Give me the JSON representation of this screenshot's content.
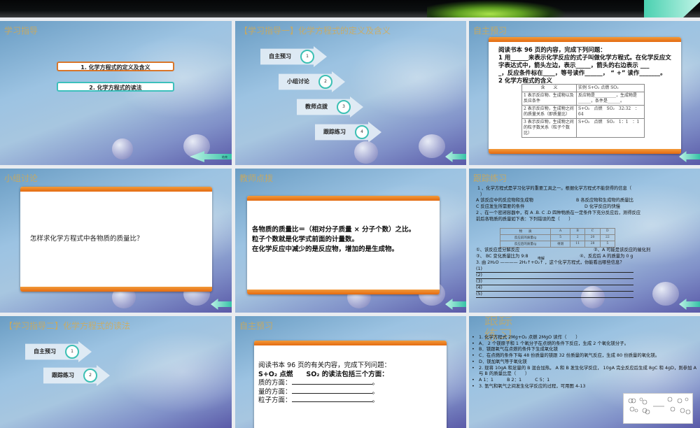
{
  "slides": [
    {
      "title": "学习指导",
      "items": [
        "1. 化学方程式的定义及含义",
        "2. 化学方程式的读法"
      ],
      "nav_label": "结束"
    },
    {
      "title": "【学习指导一】化学方程式的定义及含义",
      "steps": [
        {
          "label": "自主预习",
          "num": "1"
        },
        {
          "label": "小组讨论",
          "num": "2"
        },
        {
          "label": "教师点拨",
          "num": "3"
        },
        {
          "label": "跟踪练习",
          "num": "4"
        }
      ]
    },
    {
      "title": "自主预习",
      "lines": [
        "阅读书本 96 页的内容，完成下列问题：",
        "1 用______来表示化学反应的式子叫做化学方程式。在化学反应文字表达式中，箭头左边，表示_____，箭头的右边表示 ___",
        "_，反应条件标在____，等号读作______，  “ +” 读作_______。",
        "2 化学方程式的含义"
      ],
      "table": {
        "headers": [
          "含　　义",
          "实例 S+O₂ 点燃 SO₂"
        ],
        "rows": [
          [
            "1 表示反应物、生成物以及反应条件",
            "反应物是__________，生成物是______，条件是______。"
          ],
          [
            "2 表示反应物，生成物之间的质量关系（即质量比）",
            "S+O₂　点燃　SO₂　32:32　：　64"
          ],
          [
            "3 表示反应物，生成物之间的粒子数关系（粒子个数比）",
            "S+O₂　点燃　SO₂　1：1　：1"
          ]
        ]
      }
    },
    {
      "title": "小组讨论",
      "text": "怎样求化学方程式中各物质的质量比？"
    },
    {
      "title": "教师点拨",
      "lines": [
        "各物质的质量比＝（相对分子质量 × 分子个数）之比。",
        "粒子个数就是化学式前面的计量数。",
        "在化学反应中减少的是反应物，增加的是生成物。"
      ]
    },
    {
      "title": "跟踪练习",
      "lines": [
        "1 、化学方程式是学习化学的重要工具之一。根据化学方程式不能获得的信息（",
        "）",
        "A 该反应中的反应物和生成物",
        "B 各反应物和生成物的质量比",
        "C 反应发生所需要的条件",
        "D 化学反应的快慢",
        "2 、在一个密闭容器中，有 A .B. C .D 四种物质在一定条件下充分反应后，测得反应",
        "前后各物质的质量如下表：下列错误的是（　　）"
      ],
      "table": {
        "headers": [
          "物　　质",
          "A",
          "B",
          "C",
          "D"
        ],
        "rows": [
          [
            "反应前的质量/g",
            "5",
            "2",
            "20",
            "22"
          ],
          [
            "反应后的质量/g",
            "待测",
            "11",
            "28",
            "5"
          ]
        ]
      },
      "options": [
        "①、该反应是分解反应",
        "②、A 可能是该反应的催化剂",
        "③、 BC 变化质量比为 9:8",
        "④、反应后 A 的质量为 0 g"
      ],
      "q3": "3. 由 2H₂O ———— 2H₂↑+O₂↑ ，这个化学方程式，你能看出哪些信息？",
      "q3_cond": "电解",
      "blanks": [
        "(1)",
        "(2)",
        "(3)",
        "(4)",
        "(5)"
      ]
    },
    {
      "title": "【学习指导二】化学方程式的读法",
      "steps": [
        {
          "label": "自主预习",
          "num": "1"
        },
        {
          "label": "跟踪练习",
          "num": "2"
        }
      ]
    },
    {
      "title": "自主预习",
      "lines": [
        "阅读书本 96 页的有关内容，完成下列问题：",
        "S+O₂ 点燃　　SO₂ 的读法包括三个方面："
      ],
      "fields": [
        "质的方面：",
        "量的方面：",
        "粒子方面："
      ]
    },
    {
      "title": "跟踪练习",
      "bullets": [
        "1. 化学方程式 2Mg+O₂ 点燃 2MgO 读作（　　）",
        "A． 2 个镁原子和 1 个氧分子在点燃的条件下反应，生成 2 个氧化镁分子。",
        "B．镁跟氧气在点燃的条件下生成氧化镁",
        "C．在点燃的条件下每 48 份质量的镁跟 32 份质量的氧气反应，生成 80 份质量的氧化镁。",
        "D．镁加氧气等于氧化镁",
        "2. 现将 10gA 和足量的 B 混合加热， A 和 B 发生化学反应， 10gA 完全反应后生成 8gC 和 4gD，则参加 A 与 B 的质量比是（　　）",
        "A  1：1　　　B  2：1　　　C  5：1",
        "3. 氢气和氧气之间发生化学反应的过程，可用图 4-13"
      ]
    }
  ]
}
